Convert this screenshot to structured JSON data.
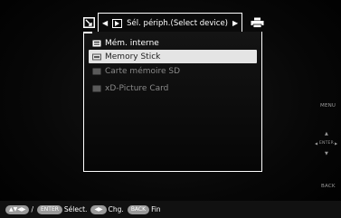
{
  "tabs": {
    "settings_icon": "settings-icon",
    "device_label": "Sél. périph.(Select device)",
    "print_icon": "print-icon"
  },
  "device_list": [
    {
      "label": "Mém. interne",
      "state": "normal"
    },
    {
      "label": "Memory Stick",
      "state": "selected"
    },
    {
      "label": "Carte mémoire SD",
      "state": "disabled"
    },
    {
      "label": "xD-Picture Card",
      "state": "disabled"
    }
  ],
  "side_buttons": {
    "menu": "MENU",
    "enter": "ENTER",
    "back": "BACK"
  },
  "bottom_hints": {
    "slash": "/",
    "enter_key": "ENTER",
    "select": "Sélect.",
    "change": "Chg.",
    "back_key": "BACK",
    "end": "Fin"
  },
  "colors": {
    "background": "#000000",
    "highlight": "#e4e4e4",
    "disabled_text": "#8a8a8a",
    "key_pill": "#9a9a9a"
  }
}
